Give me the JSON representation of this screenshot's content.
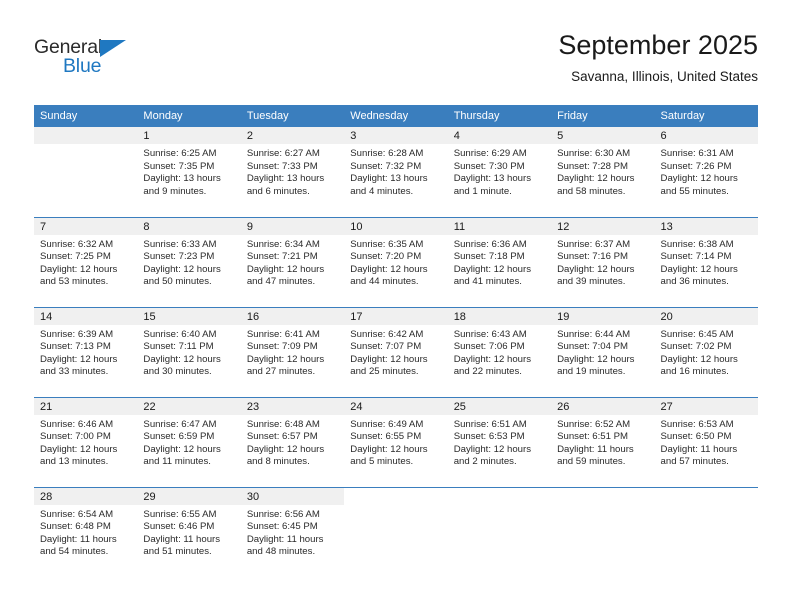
{
  "brand": {
    "name_top": "General",
    "name_bottom": "Blue",
    "triangle_color": "#1f78c1",
    "text_color": "#2b2b2b"
  },
  "header": {
    "title": "September 2025",
    "subtitle": "Savanna, Illinois, United States"
  },
  "theme": {
    "header_blue": "#3a7ebe",
    "daynum_band": "#f0f0f0",
    "text": "#1a1a1a"
  },
  "weekdays": [
    "Sunday",
    "Monday",
    "Tuesday",
    "Wednesday",
    "Thursday",
    "Friday",
    "Saturday"
  ],
  "labels": {
    "sunrise": "Sunrise:",
    "sunset": "Sunset:",
    "daylight": "Daylight:"
  },
  "weeks": [
    [
      {
        "day": "",
        "sunrise": "",
        "sunset": "",
        "daylight_line1": "",
        "daylight_line2": ""
      },
      {
        "day": "1",
        "sunrise": "Sunrise: 6:25 AM",
        "sunset": "Sunset: 7:35 PM",
        "daylight_line1": "Daylight: 13 hours",
        "daylight_line2": "and 9 minutes."
      },
      {
        "day": "2",
        "sunrise": "Sunrise: 6:27 AM",
        "sunset": "Sunset: 7:33 PM",
        "daylight_line1": "Daylight: 13 hours",
        "daylight_line2": "and 6 minutes."
      },
      {
        "day": "3",
        "sunrise": "Sunrise: 6:28 AM",
        "sunset": "Sunset: 7:32 PM",
        "daylight_line1": "Daylight: 13 hours",
        "daylight_line2": "and 4 minutes."
      },
      {
        "day": "4",
        "sunrise": "Sunrise: 6:29 AM",
        "sunset": "Sunset: 7:30 PM",
        "daylight_line1": "Daylight: 13 hours",
        "daylight_line2": "and 1 minute."
      },
      {
        "day": "5",
        "sunrise": "Sunrise: 6:30 AM",
        "sunset": "Sunset: 7:28 PM",
        "daylight_line1": "Daylight: 12 hours",
        "daylight_line2": "and 58 minutes."
      },
      {
        "day": "6",
        "sunrise": "Sunrise: 6:31 AM",
        "sunset": "Sunset: 7:26 PM",
        "daylight_line1": "Daylight: 12 hours",
        "daylight_line2": "and 55 minutes."
      }
    ],
    [
      {
        "day": "7",
        "sunrise": "Sunrise: 6:32 AM",
        "sunset": "Sunset: 7:25 PM",
        "daylight_line1": "Daylight: 12 hours",
        "daylight_line2": "and 53 minutes."
      },
      {
        "day": "8",
        "sunrise": "Sunrise: 6:33 AM",
        "sunset": "Sunset: 7:23 PM",
        "daylight_line1": "Daylight: 12 hours",
        "daylight_line2": "and 50 minutes."
      },
      {
        "day": "9",
        "sunrise": "Sunrise: 6:34 AM",
        "sunset": "Sunset: 7:21 PM",
        "daylight_line1": "Daylight: 12 hours",
        "daylight_line2": "and 47 minutes."
      },
      {
        "day": "10",
        "sunrise": "Sunrise: 6:35 AM",
        "sunset": "Sunset: 7:20 PM",
        "daylight_line1": "Daylight: 12 hours",
        "daylight_line2": "and 44 minutes."
      },
      {
        "day": "11",
        "sunrise": "Sunrise: 6:36 AM",
        "sunset": "Sunset: 7:18 PM",
        "daylight_line1": "Daylight: 12 hours",
        "daylight_line2": "and 41 minutes."
      },
      {
        "day": "12",
        "sunrise": "Sunrise: 6:37 AM",
        "sunset": "Sunset: 7:16 PM",
        "daylight_line1": "Daylight: 12 hours",
        "daylight_line2": "and 39 minutes."
      },
      {
        "day": "13",
        "sunrise": "Sunrise: 6:38 AM",
        "sunset": "Sunset: 7:14 PM",
        "daylight_line1": "Daylight: 12 hours",
        "daylight_line2": "and 36 minutes."
      }
    ],
    [
      {
        "day": "14",
        "sunrise": "Sunrise: 6:39 AM",
        "sunset": "Sunset: 7:13 PM",
        "daylight_line1": "Daylight: 12 hours",
        "daylight_line2": "and 33 minutes."
      },
      {
        "day": "15",
        "sunrise": "Sunrise: 6:40 AM",
        "sunset": "Sunset: 7:11 PM",
        "daylight_line1": "Daylight: 12 hours",
        "daylight_line2": "and 30 minutes."
      },
      {
        "day": "16",
        "sunrise": "Sunrise: 6:41 AM",
        "sunset": "Sunset: 7:09 PM",
        "daylight_line1": "Daylight: 12 hours",
        "daylight_line2": "and 27 minutes."
      },
      {
        "day": "17",
        "sunrise": "Sunrise: 6:42 AM",
        "sunset": "Sunset: 7:07 PM",
        "daylight_line1": "Daylight: 12 hours",
        "daylight_line2": "and 25 minutes."
      },
      {
        "day": "18",
        "sunrise": "Sunrise: 6:43 AM",
        "sunset": "Sunset: 7:06 PM",
        "daylight_line1": "Daylight: 12 hours",
        "daylight_line2": "and 22 minutes."
      },
      {
        "day": "19",
        "sunrise": "Sunrise: 6:44 AM",
        "sunset": "Sunset: 7:04 PM",
        "daylight_line1": "Daylight: 12 hours",
        "daylight_line2": "and 19 minutes."
      },
      {
        "day": "20",
        "sunrise": "Sunrise: 6:45 AM",
        "sunset": "Sunset: 7:02 PM",
        "daylight_line1": "Daylight: 12 hours",
        "daylight_line2": "and 16 minutes."
      }
    ],
    [
      {
        "day": "21",
        "sunrise": "Sunrise: 6:46 AM",
        "sunset": "Sunset: 7:00 PM",
        "daylight_line1": "Daylight: 12 hours",
        "daylight_line2": "and 13 minutes."
      },
      {
        "day": "22",
        "sunrise": "Sunrise: 6:47 AM",
        "sunset": "Sunset: 6:59 PM",
        "daylight_line1": "Daylight: 12 hours",
        "daylight_line2": "and 11 minutes."
      },
      {
        "day": "23",
        "sunrise": "Sunrise: 6:48 AM",
        "sunset": "Sunset: 6:57 PM",
        "daylight_line1": "Daylight: 12 hours",
        "daylight_line2": "and 8 minutes."
      },
      {
        "day": "24",
        "sunrise": "Sunrise: 6:49 AM",
        "sunset": "Sunset: 6:55 PM",
        "daylight_line1": "Daylight: 12 hours",
        "daylight_line2": "and 5 minutes."
      },
      {
        "day": "25",
        "sunrise": "Sunrise: 6:51 AM",
        "sunset": "Sunset: 6:53 PM",
        "daylight_line1": "Daylight: 12 hours",
        "daylight_line2": "and 2 minutes."
      },
      {
        "day": "26",
        "sunrise": "Sunrise: 6:52 AM",
        "sunset": "Sunset: 6:51 PM",
        "daylight_line1": "Daylight: 11 hours",
        "daylight_line2": "and 59 minutes."
      },
      {
        "day": "27",
        "sunrise": "Sunrise: 6:53 AM",
        "sunset": "Sunset: 6:50 PM",
        "daylight_line1": "Daylight: 11 hours",
        "daylight_line2": "and 57 minutes."
      }
    ],
    [
      {
        "day": "28",
        "sunrise": "Sunrise: 6:54 AM",
        "sunset": "Sunset: 6:48 PM",
        "daylight_line1": "Daylight: 11 hours",
        "daylight_line2": "and 54 minutes."
      },
      {
        "day": "29",
        "sunrise": "Sunrise: 6:55 AM",
        "sunset": "Sunset: 6:46 PM",
        "daylight_line1": "Daylight: 11 hours",
        "daylight_line2": "and 51 minutes."
      },
      {
        "day": "30",
        "sunrise": "Sunrise: 6:56 AM",
        "sunset": "Sunset: 6:45 PM",
        "daylight_line1": "Daylight: 11 hours",
        "daylight_line2": "and 48 minutes."
      },
      {
        "day": "",
        "sunrise": "",
        "sunset": "",
        "daylight_line1": "",
        "daylight_line2": ""
      },
      {
        "day": "",
        "sunrise": "",
        "sunset": "",
        "daylight_line1": "",
        "daylight_line2": ""
      },
      {
        "day": "",
        "sunrise": "",
        "sunset": "",
        "daylight_line1": "",
        "daylight_line2": ""
      },
      {
        "day": "",
        "sunrise": "",
        "sunset": "",
        "daylight_line1": "",
        "daylight_line2": ""
      }
    ]
  ]
}
